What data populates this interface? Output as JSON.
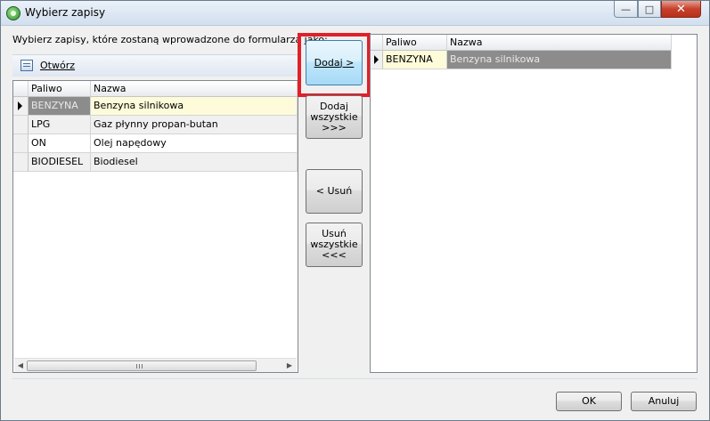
{
  "window": {
    "title": "Wybierz zapisy",
    "controls": [
      "minimize-icon",
      "maximize-icon",
      "close-icon"
    ]
  },
  "instruction": "Wybierz zapisy, które zostaną wprowadzone do formularza jako:",
  "open_button": {
    "label": "Otwórz",
    "icon": "document-icon"
  },
  "left_grid": {
    "columns": [
      "Paliwo",
      "Nazwa"
    ],
    "rows": [
      {
        "paliwo": "BENZYNA",
        "nazwa": "Benzyna silnikowa",
        "current": true
      },
      {
        "paliwo": "LPG",
        "nazwa": "Gaz płynny propan-butan",
        "current": false
      },
      {
        "paliwo": "ON",
        "nazwa": "Olej napędowy",
        "current": false
      },
      {
        "paliwo": "BIODIESEL",
        "nazwa": "Biodiesel",
        "current": false
      }
    ]
  },
  "right_grid": {
    "columns": [
      "Paliwo",
      "Nazwa"
    ],
    "rows": [
      {
        "paliwo": "BENZYNA",
        "nazwa": "Benzyna silnikowa",
        "current": true
      }
    ]
  },
  "middle_buttons": {
    "add": "Dodaj >",
    "add_all": "Dodaj\nwszystkie\n>>>",
    "remove": "< Usuń",
    "remove_all": "Usuń\nwszystkie\n<<<"
  },
  "footer": {
    "ok": "OK",
    "cancel": "Anuluj"
  },
  "colors": {
    "highlight": "#e0202a",
    "selected_cell": "#fdfbd9",
    "selected_row_gray": "#8c8c8c"
  }
}
